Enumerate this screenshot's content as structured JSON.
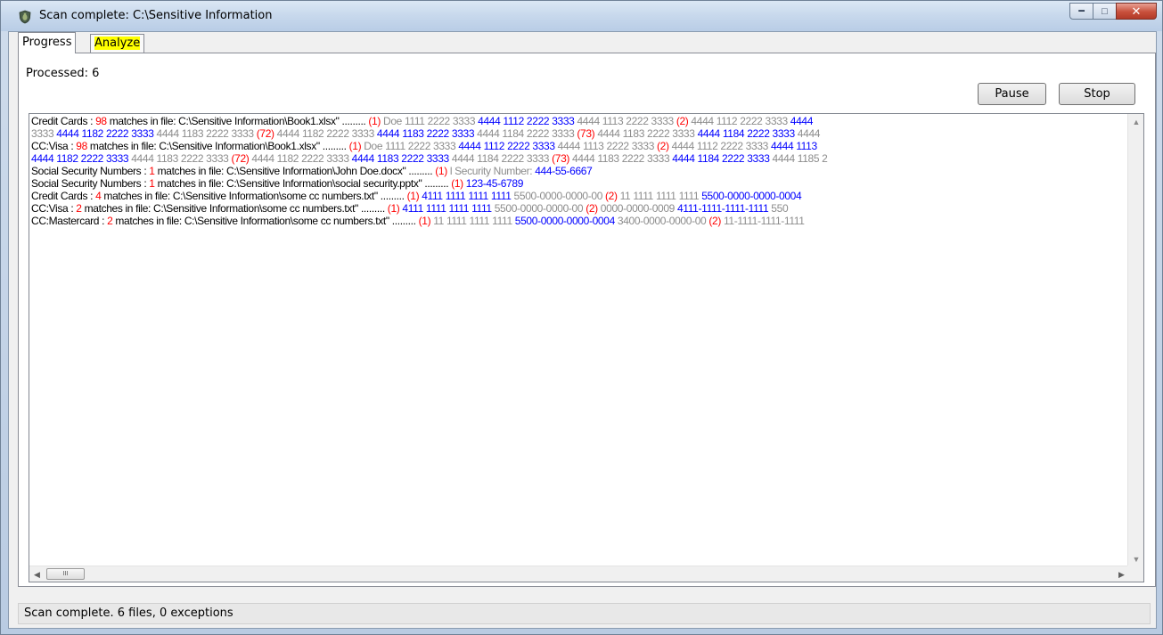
{
  "window": {
    "title": "Scan complete: C:\\Sensitive Information",
    "icon": "shield-bug-icon",
    "controls": {
      "minimize": "minimize-icon",
      "maximize": "maximize-icon",
      "close": "close-icon"
    }
  },
  "tabs": [
    {
      "label": "Progress",
      "active": true
    },
    {
      "label": "Analyze",
      "active": false,
      "highlight": "#ffff00"
    }
  ],
  "progress": {
    "processed_label": "Processed: 6",
    "pause_label": "Pause",
    "stop_label": "Stop"
  },
  "colors": {
    "count": "#ff0000",
    "context": "#8c8c8c",
    "match": "#0000ff",
    "text": "#000000"
  },
  "results": [
    {
      "segments": [
        {
          "c": "t",
          "v": "Credit Cards : "
        },
        {
          "c": "r",
          "v": "98"
        },
        {
          "c": "t",
          "v": " matches in file: C:\\Sensitive Information\\Book1.xlsx\" ......... "
        },
        {
          "c": "r",
          "v": "(1)"
        },
        {
          "c": "g",
          "v": " Doe 1111 2222 3333 "
        },
        {
          "c": "b",
          "v": "4444 1112 2222 3333"
        },
        {
          "c": "g",
          "v": " 4444 1113 2222 3333 "
        },
        {
          "c": "r",
          "v": "(2)"
        },
        {
          "c": "g",
          "v": " 4444 1112 2222 3333 "
        },
        {
          "c": "b",
          "v": "4444"
        }
      ]
    },
    {
      "segments": [
        {
          "c": "g",
          "v": "3333 "
        },
        {
          "c": "b",
          "v": "4444 1182 2222 3333"
        },
        {
          "c": "g",
          "v": " 4444 1183 2222 3333 "
        },
        {
          "c": "r",
          "v": "(72)"
        },
        {
          "c": "g",
          "v": " 4444 1182 2222 3333 "
        },
        {
          "c": "b",
          "v": "4444 1183 2222 3333"
        },
        {
          "c": "g",
          "v": " 4444 1184 2222 3333 "
        },
        {
          "c": "r",
          "v": "(73)"
        },
        {
          "c": "g",
          "v": " 4444 1183 2222 3333 "
        },
        {
          "c": "b",
          "v": "4444 1184 2222 3333"
        },
        {
          "c": "g",
          "v": " 4444"
        }
      ]
    },
    {
      "segments": [
        {
          "c": "t",
          "v": "CC:Visa : "
        },
        {
          "c": "r",
          "v": "98"
        },
        {
          "c": "t",
          "v": " matches in file: C:\\Sensitive Information\\Book1.xlsx\" ......... "
        },
        {
          "c": "r",
          "v": "(1)"
        },
        {
          "c": "g",
          "v": " Doe 1111 2222 3333 "
        },
        {
          "c": "b",
          "v": "4444 1112 2222 3333"
        },
        {
          "c": "g",
          "v": " 4444 1113 2222 3333 "
        },
        {
          "c": "r",
          "v": "(2)"
        },
        {
          "c": "g",
          "v": " 4444 1112 2222 3333 "
        },
        {
          "c": "b",
          "v": "4444 1113"
        }
      ]
    },
    {
      "segments": [
        {
          "c": "b",
          "v": "4444 1182 2222 3333"
        },
        {
          "c": "g",
          "v": " 4444 1183 2222 3333 "
        },
        {
          "c": "r",
          "v": "(72)"
        },
        {
          "c": "g",
          "v": " 4444 1182 2222 3333 "
        },
        {
          "c": "b",
          "v": "4444 1183 2222 3333"
        },
        {
          "c": "g",
          "v": " 4444 1184 2222 3333 "
        },
        {
          "c": "r",
          "v": "(73)"
        },
        {
          "c": "g",
          "v": " 4444 1183 2222 3333 "
        },
        {
          "c": "b",
          "v": "4444 1184 2222 3333"
        },
        {
          "c": "g",
          "v": " 4444 1185 2"
        }
      ]
    },
    {
      "segments": [
        {
          "c": "t",
          "v": "Social Security Numbers : "
        },
        {
          "c": "r",
          "v": "1"
        },
        {
          "c": "t",
          "v": " matches in file: C:\\Sensitive Information\\John Doe.docx\" ......... "
        },
        {
          "c": "r",
          "v": "(1)"
        },
        {
          "c": "g",
          "v": " l Security Number:  "
        },
        {
          "c": "b",
          "v": "444-55-6667"
        }
      ]
    },
    {
      "segments": [
        {
          "c": "t",
          "v": "Social Security Numbers : "
        },
        {
          "c": "r",
          "v": "1"
        },
        {
          "c": "t",
          "v": " matches in file: C:\\Sensitive Information\\social security.pptx\" ......... "
        },
        {
          "c": "r",
          "v": "(1)"
        },
        {
          "c": "b",
          "v": " 123-45-6789"
        }
      ]
    },
    {
      "segments": [
        {
          "c": "t",
          "v": "Credit Cards : "
        },
        {
          "c": "r",
          "v": "4"
        },
        {
          "c": "t",
          "v": " matches in file: C:\\Sensitive Information\\some cc numbers.txt\" ......... "
        },
        {
          "c": "r",
          "v": "(1)"
        },
        {
          "c": "b",
          "v": " 4111 1111 1111 1111"
        },
        {
          "c": "g",
          "v": "     5500-0000-0000-00 "
        },
        {
          "c": "r",
          "v": "(2)"
        },
        {
          "c": "g",
          "v": " 11 1111 1111 1111     "
        },
        {
          "c": "b",
          "v": "5500-0000-0000-0004"
        }
      ]
    },
    {
      "segments": [
        {
          "c": "t",
          "v": "CC:Visa : "
        },
        {
          "c": "r",
          "v": "2"
        },
        {
          "c": "t",
          "v": " matches in file: C:\\Sensitive Information\\some cc numbers.txt\" ......... "
        },
        {
          "c": "r",
          "v": "(1)"
        },
        {
          "c": "b",
          "v": " 4111 1111 1111 1111"
        },
        {
          "c": "g",
          "v": "     5500-0000-0000-00 "
        },
        {
          "c": "r",
          "v": "(2)"
        },
        {
          "c": "g",
          "v": " 0000-0000-0009     "
        },
        {
          "c": "b",
          "v": "4111-1111-1111-1111"
        },
        {
          "c": "g",
          "v": "     550"
        }
      ]
    },
    {
      "segments": [
        {
          "c": "t",
          "v": "CC:Mastercard : "
        },
        {
          "c": "r",
          "v": "2"
        },
        {
          "c": "t",
          "v": " matches in file: C:\\Sensitive Information\\some cc numbers.txt\" ......... "
        },
        {
          "c": "r",
          "v": "(1)"
        },
        {
          "c": "g",
          "v": " 11 1111 1111 1111     "
        },
        {
          "c": "b",
          "v": "5500-0000-0000-0004"
        },
        {
          "c": "g",
          "v": "     3400-0000-0000-00 "
        },
        {
          "c": "r",
          "v": "(2)"
        },
        {
          "c": "g",
          "v": " 11-1111-1111-1111"
        }
      ]
    }
  ],
  "scrollbar": {
    "thumb_glyph": "III",
    "left_arrow": "◀",
    "right_arrow": "▶",
    "up_arrow": "▲",
    "down_arrow": "▼"
  },
  "status": {
    "text": "Scan complete. 6 files, 0 exceptions"
  }
}
